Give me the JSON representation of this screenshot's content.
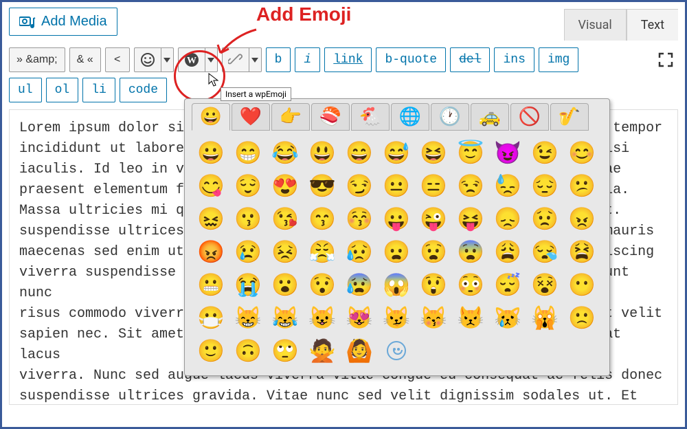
{
  "annotation": {
    "label": "Add Emoji"
  },
  "buttons": {
    "add_media": "Add Media"
  },
  "tabs": {
    "visual": "Visual",
    "text": "Text",
    "active": "text"
  },
  "tooltip": "Insert a wpEmoji",
  "toolbar_row1": {
    "amp_raw": "» &amp;",
    "amp_entity": "& «",
    "lt": "<",
    "b": "b",
    "i": "i",
    "link": "link",
    "bquote": "b-quote",
    "del": "del",
    "ins": "ins",
    "img": "img"
  },
  "toolbar_row2": {
    "ul": "ul",
    "ol": "ol",
    "li": "li",
    "code": "code"
  },
  "emoji_categories": [
    "😀",
    "❤️",
    "👉",
    "🍣",
    "🐔",
    "🌐",
    "🕐",
    "🚕",
    "🚫",
    "🎷"
  ],
  "emoji_grid": [
    [
      "😀",
      "😁",
      "😂",
      "😃",
      "😄",
      "😅",
      "😆",
      "😇",
      "😈",
      "😉",
      "😊"
    ],
    [
      "😋",
      "😌",
      "😍",
      "😎",
      "😏",
      "😐",
      "😑",
      "😒",
      "😓",
      "😔",
      "😕"
    ],
    [
      "😖",
      "😗",
      "😘",
      "😙",
      "😚",
      "😛",
      "😜",
      "😝",
      "😞",
      "😟",
      "😠"
    ],
    [
      "😡",
      "😢",
      "😣",
      "😤",
      "😥",
      "😦",
      "😧",
      "😨",
      "😩",
      "😪",
      "😫"
    ],
    [
      "😬",
      "😭",
      "😮",
      "😯",
      "😰",
      "😱",
      "😲",
      "😳",
      "😴",
      "😵",
      "😶"
    ],
    [
      "😷",
      "😸",
      "😹",
      "😺",
      "😻",
      "😼",
      "😽",
      "😾",
      "😿",
      "🙀",
      "🙁"
    ],
    [
      "🙂",
      "🙃",
      "🙄",
      "🙅",
      "🙆",
      "⬜",
      "",
      "",
      "",
      "",
      ""
    ]
  ],
  "content_text": "Lorem ipsum dolor sit amet, consectetur adipiscing elit, sed do eiusmod tempor\nincididunt ut labore et dolore magna aliqua. Viverra accumsan in nisl nisi\niaculis. Id leo in vitae turpis massa sed elementum tempus egestas. Vitae\npraesent elementum facilisis leo vel fringilla est ullamcorper eget nulla.\nMassa ultricies mi quis hendrerit. Quis lectus nulla at volutpat diam ut.\nsuspendisse ultrices gravida dictum fusce ut placerat orci nulla. Amet mauris\nmaecenas sed enim ut sem viverra aliquet eget sit amet tellus cras adipiscing\nviverra suspendisse potenti nullam. Commodo quis imperdiet massa tincidunt nunc\nrisus commodo viverra maecenas accumsan lacus vel facilisis volutpat est velit\nsapien nec. Sit amet nulla facilisi morbi tempus iaculis urna id volutpat lacus\nviverra. Nunc sed augue lacus viverra vitae congue eu consequat ac felis donec\nsuspendisse ultrices gravida. Vitae nunc sed velit dignissim sodales ut. Et\nnetus et malesuada fames ac turpis egestas. Enim neque volutpat ac tincidunt",
  "chart_data": null
}
